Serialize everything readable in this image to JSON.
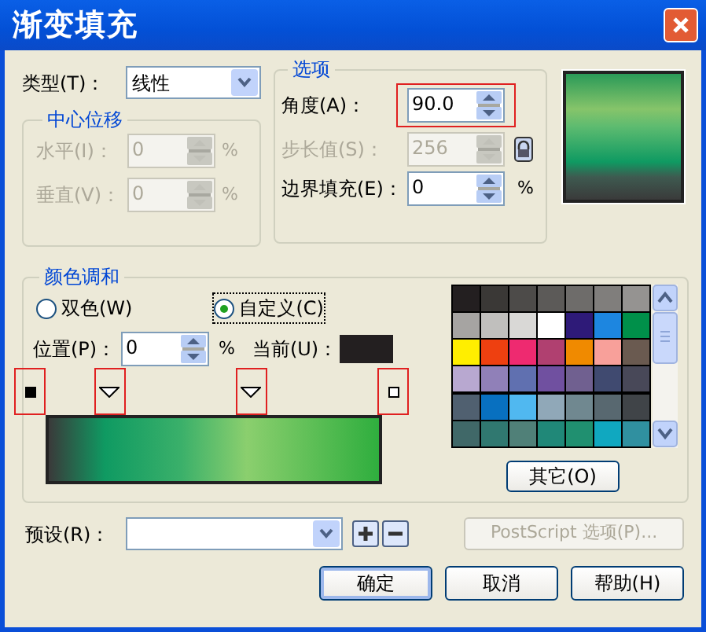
{
  "window": {
    "title": "渐变填充"
  },
  "type": {
    "label": "类型(T)：",
    "value": "线性"
  },
  "center_offset": {
    "title": "中心位移",
    "fields": [
      {
        "label": "水平(I)：",
        "value": "0",
        "unit": "%",
        "disabled": true
      },
      {
        "label": "垂直(V)：",
        "value": "0",
        "unit": "%",
        "disabled": true
      }
    ]
  },
  "options": {
    "title": "选项",
    "fields": [
      {
        "label": "角度(A)：",
        "value": "90.0",
        "disabled": false,
        "highlighted": true,
        "locked": false
      },
      {
        "label": "步长值(S)：",
        "value": "256",
        "disabled": true,
        "highlighted": false,
        "locked": true
      },
      {
        "label": "边界填充(E)：",
        "value": "0",
        "unit": "%",
        "disabled": false,
        "highlighted": false,
        "locked": false
      }
    ]
  },
  "color_blend": {
    "title": "颜色调和",
    "modes": [
      {
        "label": "双色(W)",
        "selected": false
      },
      {
        "label": "自定义(C)",
        "selected": true
      }
    ],
    "position": {
      "label": "位置(P)：",
      "value": "0",
      "unit": "%"
    },
    "current": {
      "label": "当前(U)：",
      "color": "#231f20"
    },
    "markers": [
      {
        "kind": "end",
        "selected": true,
        "highlighted": true,
        "level": 0
      },
      {
        "kind": "mid",
        "selected": false,
        "highlighted": true,
        "level": 0.22
      },
      {
        "kind": "mid",
        "selected": false,
        "highlighted": true,
        "level": 0.61
      },
      {
        "kind": "end",
        "selected": false,
        "highlighted": true,
        "level": 1
      }
    ],
    "palette": [
      {
        "color": "#231f20"
      },
      {
        "color": "#3a3836"
      },
      {
        "color": "#4d4b49"
      },
      {
        "color": "#5c5a58"
      },
      {
        "color": "#6e6c6a"
      },
      {
        "color": "#807e7c"
      },
      {
        "color": "#959391"
      },
      {
        "color": "#a6a4a2"
      },
      {
        "color": "#c0bfbd"
      },
      {
        "color": "#d9d8d6"
      },
      {
        "color": "#ffffff"
      },
      {
        "color": "#2e1a78"
      },
      {
        "color": "#1d86e0"
      },
      {
        "color": "#00904a"
      },
      {
        "color": "#ffee00"
      },
      {
        "color": "#ee4010"
      },
      {
        "color": "#ee2a70"
      },
      {
        "color": "#b04070"
      },
      {
        "color": "#f08a00"
      },
      {
        "color": "#f8a09a"
      },
      {
        "color": "#6a5a50"
      },
      {
        "color": "#b8a8d0"
      },
      {
        "color": "#9080b8"
      },
      {
        "color": "#6070b0"
      },
      {
        "color": "#7050a0"
      },
      {
        "color": "#706090"
      },
      {
        "color": "#404a70"
      },
      {
        "color": "#484858"
      },
      {
        "color": "#506070"
      },
      {
        "color": "#0870c0"
      },
      {
        "color": "#50b8f0"
      },
      {
        "color": "#90a8b8"
      },
      {
        "color": "#708890"
      },
      {
        "color": "#586870"
      },
      {
        "color": "#404448"
      },
      {
        "color": "#406868"
      },
      {
        "color": "#307870"
      },
      {
        "color": "#508078"
      },
      {
        "color": "#208878"
      },
      {
        "color": "#209070"
      },
      {
        "color": "#10a8c0"
      },
      {
        "color": "#3090a0"
      }
    ],
    "other_button": "其它(O)"
  },
  "preset": {
    "label": "预设(R)："
  },
  "postscript_button": {
    "label": "PostScript 选项(P)...",
    "disabled": true
  },
  "buttons": [
    {
      "label": "确定",
      "default": true
    },
    {
      "label": "取消",
      "default": false
    },
    {
      "label": "帮助(H)",
      "default": false
    }
  ]
}
